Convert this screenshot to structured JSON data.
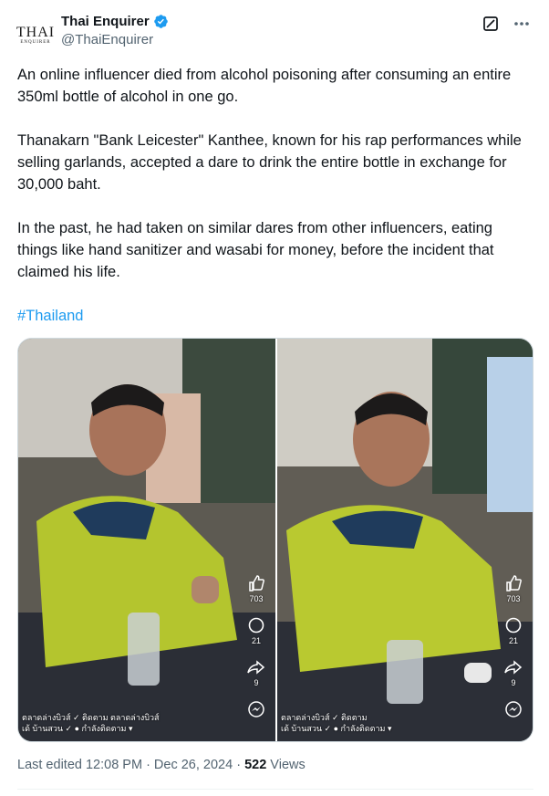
{
  "account": {
    "display_name": "Thai Enquirer",
    "handle": "@ThaiEnquirer",
    "logo_text": "THAI",
    "logo_subtext": "ENQUIRER"
  },
  "post": {
    "paragraphs": [
      "An online influencer died from alcohol poisoning after consuming an entire 350ml bottle of alcohol in one go.",
      "Thanakarn \"Bank Leicester\" Kanthee, known for his rap performances while selling garlands, accepted a dare to drink the entire bottle in exchange for 30,000 baht.",
      "In the past, he had taken on similar dares from other influencers, eating things like hand sanitizer and wasabi for money, before the incident that claimed his life."
    ],
    "hashtag": "#Thailand"
  },
  "media": {
    "frames": [
      {
        "likes": "703",
        "comments": "21",
        "shares": "9",
        "overlay_line1": "ตลาดล่างบิวส์ ✓ ติดตาม ตลาดล่างบิวส์",
        "overlay_line2": "เด้ บ้านสวน ✓ ● กำลังติดตาม ▾"
      },
      {
        "likes": "703",
        "comments": "21",
        "shares": "9",
        "overlay_line1": "ตลาดล่างบิวส์ ✓ ติดตาม",
        "overlay_line2": "เด้ บ้านสวน ✓ ● กำลังติดตาม ▾"
      }
    ]
  },
  "meta": {
    "edited_label": "Last edited 12:08 PM · Dec 26, 2024 · ",
    "views_count": "522",
    "views_label": " Views"
  },
  "colors": {
    "accent": "#1d9bf0",
    "muted": "#536471",
    "text": "#0f1419"
  }
}
